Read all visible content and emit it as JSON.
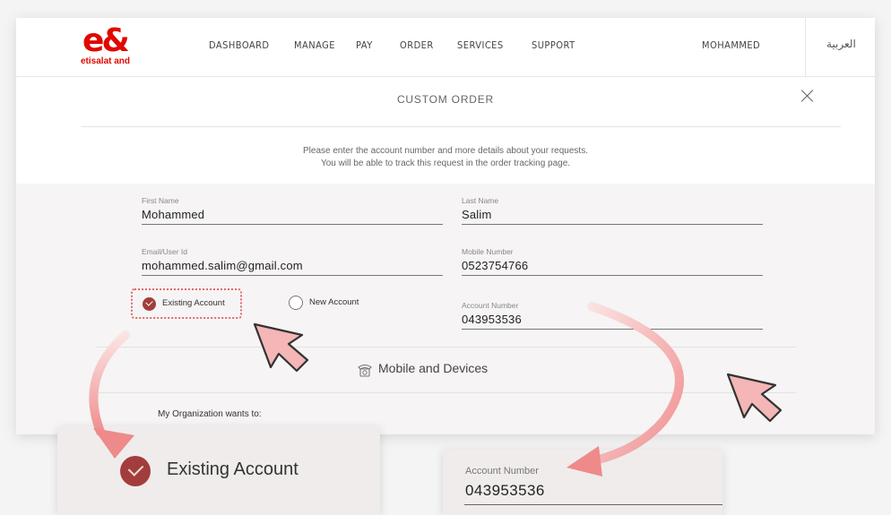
{
  "brand": {
    "name": "etisalat and",
    "mark": "e&",
    "accent": "#e00800"
  },
  "nav": [
    {
      "label": "DASHBOARD"
    },
    {
      "label": "MANAGE"
    },
    {
      "label": "PAY"
    },
    {
      "label": "ORDER"
    },
    {
      "label": "SERVICES"
    },
    {
      "label": "SUPPORT"
    }
  ],
  "user": {
    "name": "MOHAMMED"
  },
  "language": {
    "label": "العربية"
  },
  "page": {
    "title": "CUSTOM ORDER"
  },
  "intro": {
    "line1": "Please enter the account number and more details about your requests.",
    "line2": "You will be able to track this request in the order tracking page."
  },
  "form": {
    "first_name": {
      "label": "First Name",
      "value": "Mohammed"
    },
    "last_name": {
      "label": "Last Name",
      "value": "Salim"
    },
    "email": {
      "label": "Email/User Id",
      "value": "mohammed.salim@gmail.com"
    },
    "mobile": {
      "label": "Mobile Number",
      "value": "0523754766"
    },
    "account": {
      "label": "Account Number",
      "value": "043953536"
    },
    "account_type": {
      "selected": "Existing Account",
      "options": [
        {
          "label": "Existing Account",
          "checked": true
        },
        {
          "label": "New Account",
          "checked": false
        }
      ]
    }
  },
  "section": {
    "title": "Mobile and Devices",
    "icon": "phone-icon"
  },
  "organization": {
    "label": "My Organization wants to:"
  },
  "zoom": {
    "existing_label": "Existing Account",
    "account_label": "Account Number",
    "account_value": "043953536"
  },
  "colors": {
    "selected_radio": "#a33d3d",
    "highlight": "#e26a6a",
    "arrow": "#f2b3b3"
  }
}
